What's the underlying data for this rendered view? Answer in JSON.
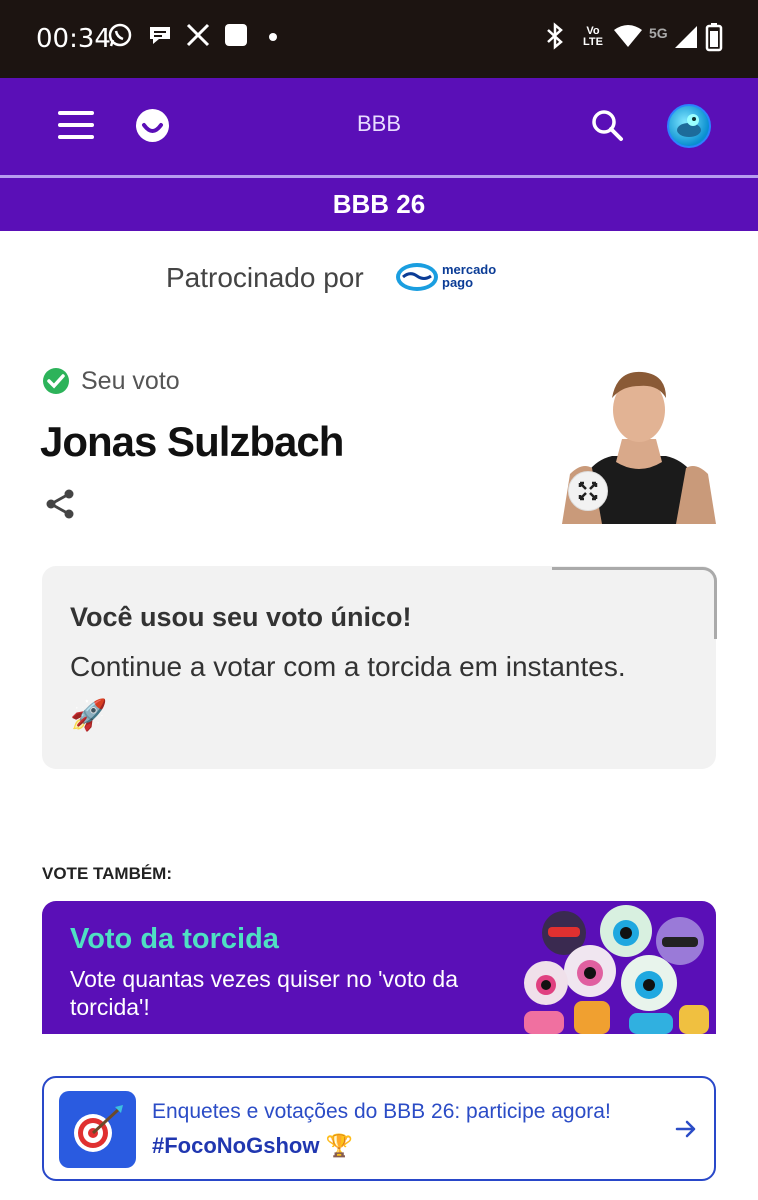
{
  "status_bar": {
    "time": "00:34",
    "network": "5G",
    "icons": [
      "whatsapp-icon",
      "chat-icon",
      "x-icon",
      "app-square-icon",
      "dot-icon",
      "bluetooth-icon",
      "volte-icon",
      "wifi-icon",
      "signal-icon",
      "battery-icon"
    ],
    "volte_label": "Vo LTE"
  },
  "header": {
    "title": "BBB",
    "subheader": "BBB 26",
    "colors": {
      "bg": "#5a0fb7"
    }
  },
  "sponsor": {
    "label": "Patrocinado por",
    "brand_line1": "mercado",
    "brand_line2": "pago"
  },
  "vote": {
    "status_label": "Seu voto",
    "name": "Jonas Sulzbach"
  },
  "card": {
    "title": "Você usou seu voto único!",
    "text": "Continue a votar com a torcida em instantes.",
    "emoji": "🚀"
  },
  "vote_too": {
    "label": "VOTE TAMBÉM:",
    "promo_title": "Voto da torcida",
    "promo_subtitle": "Vote quantas vezes quiser no 'voto da torcida'!"
  },
  "link": {
    "text": "Enquetes e votações do BBB 26: participe agora!",
    "tag": "#FocoNoGshow 🏆"
  }
}
